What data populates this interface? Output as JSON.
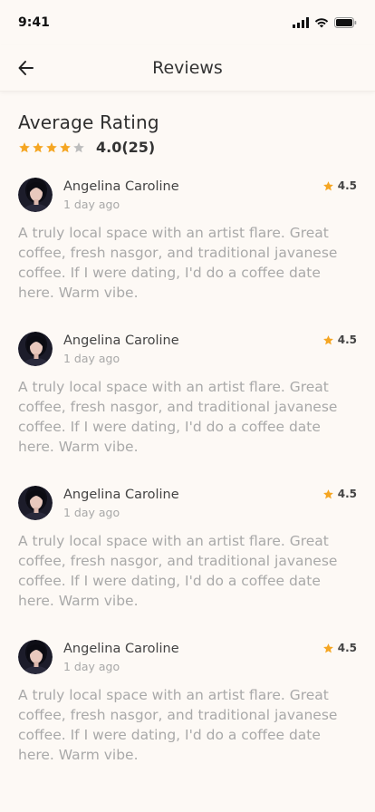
{
  "status_bar": {
    "time": "9:41"
  },
  "header": {
    "title": "Reviews"
  },
  "summary": {
    "title": "Average Rating",
    "score_text": "4.0(25)",
    "rating": 4.0,
    "max_rating": 5
  },
  "reviews": [
    {
      "name": "Angelina Caroline",
      "date": "1 day ago",
      "rating": "4.5",
      "text": "A truly local space with an artist flare. Great coffee, fresh nasgor, and traditional javanese coffee. If I were dating, I'd do a coffee date here. Warm vibe."
    },
    {
      "name": "Angelina Caroline",
      "date": "1 day ago",
      "rating": "4.5",
      "text": "A truly local space with an artist flare. Great coffee, fresh nasgor, and traditional javanese coffee. If I were dating, I'd do a coffee date here. Warm vibe."
    },
    {
      "name": "Angelina Caroline",
      "date": "1 day ago",
      "rating": "4.5",
      "text": "A truly local space with an artist flare. Great coffee, fresh nasgor, and traditional javanese coffee. If I were dating, I'd do a coffee date here. Warm vibe."
    },
    {
      "name": "Angelina Caroline",
      "date": "1 day ago",
      "rating": "4.5",
      "text": "A truly local space with an artist flare. Great coffee, fresh nasgor, and traditional javanese coffee. If I were dating, I'd do a coffee date here. Warm vibe."
    }
  ],
  "colors": {
    "star": "#f5a623",
    "star_empty": "#bdbdbd",
    "background": "#fdf9f5"
  }
}
